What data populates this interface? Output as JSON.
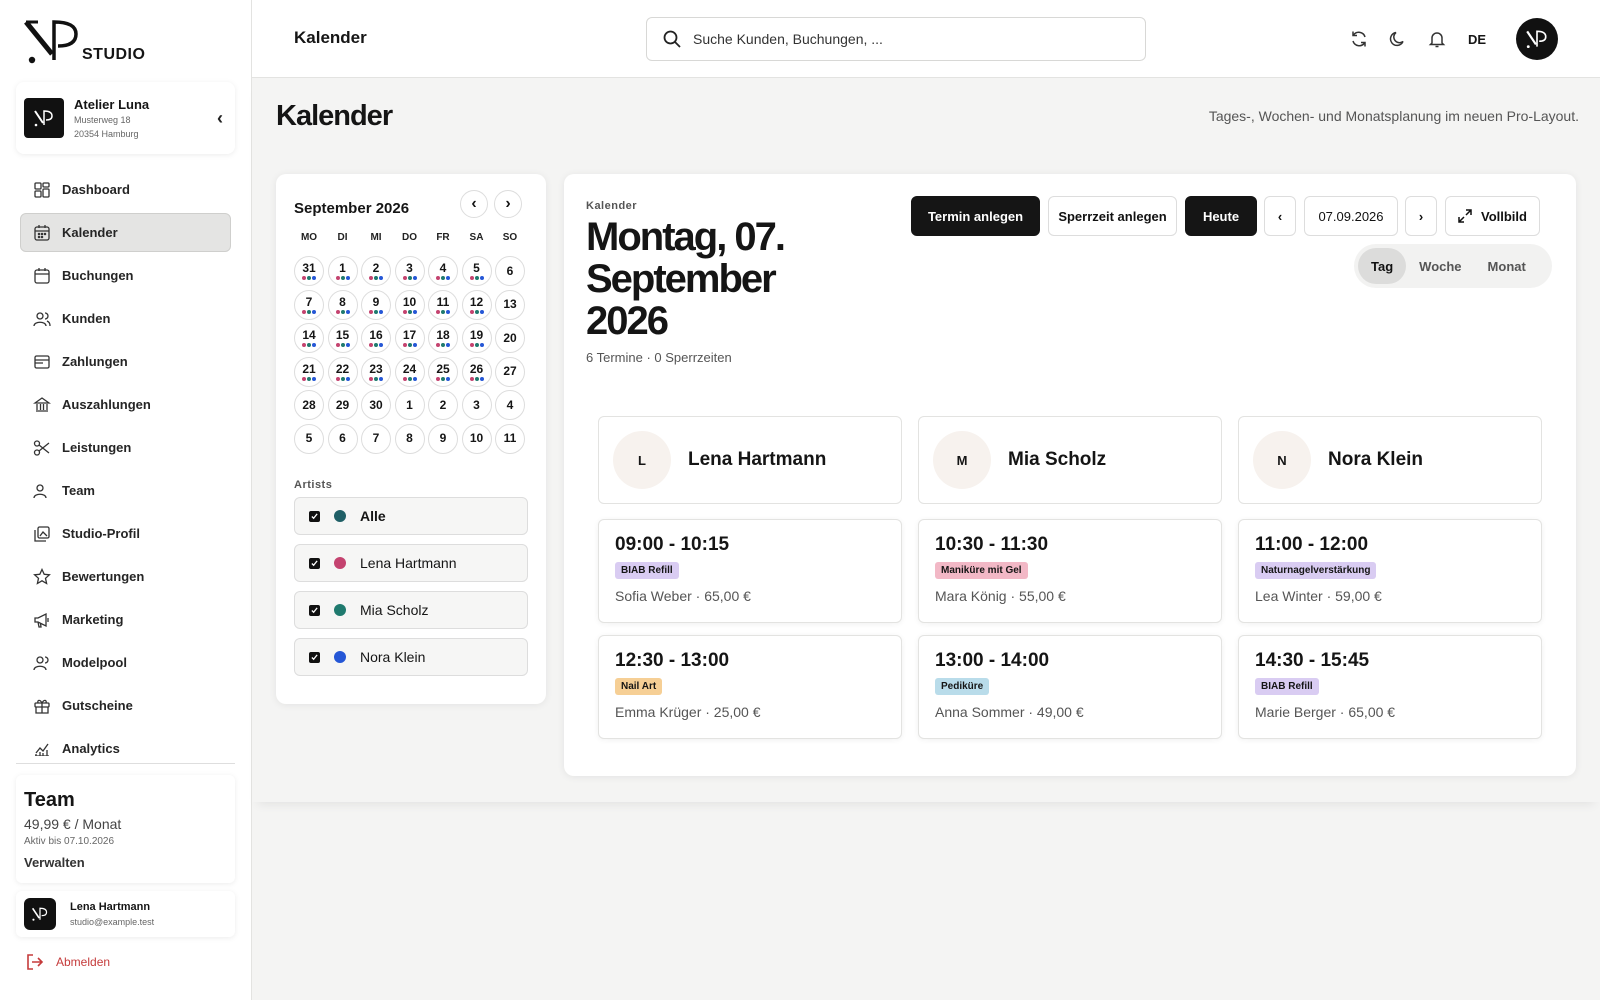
{
  "brand": {
    "word": "STUDIO"
  },
  "studio": {
    "name": "Atelier Luna",
    "street": "Musterweg 18",
    "city": "20354 Hamburg"
  },
  "nav": {
    "items": [
      {
        "label": "Dashboard",
        "icon": "dashboard-icon"
      },
      {
        "label": "Kalender",
        "icon": "calendar-icon",
        "active": true
      },
      {
        "label": "Buchungen",
        "icon": "bookings-icon"
      },
      {
        "label": "Kunden",
        "icon": "customers-icon"
      },
      {
        "label": "Zahlungen",
        "icon": "payments-icon"
      },
      {
        "label": "Auszahlungen",
        "icon": "bank-icon"
      },
      {
        "label": "Leistungen",
        "icon": "scissors-icon"
      },
      {
        "label": "Team",
        "icon": "team-icon"
      },
      {
        "label": "Studio-Profil",
        "icon": "profile-icon"
      },
      {
        "label": "Bewertungen",
        "icon": "star-icon"
      },
      {
        "label": "Marketing",
        "icon": "megaphone-icon"
      },
      {
        "label": "Modelpool",
        "icon": "modelpool-icon"
      },
      {
        "label": "Gutscheine",
        "icon": "gift-icon"
      },
      {
        "label": "Analytics",
        "icon": "chart-icon"
      }
    ]
  },
  "plan": {
    "name": "Team",
    "price": "49,99 € / Monat",
    "until": "Aktiv bis 07.10.2026",
    "manage": "Verwalten"
  },
  "user": {
    "name": "Lena Hartmann",
    "email": "studio@example.test"
  },
  "logout": "Abmelden",
  "topbar": {
    "title": "Kalender",
    "search_placeholder": "Suche Kunden, Buchungen, ...",
    "lang": "DE"
  },
  "page": {
    "title": "Kalender",
    "subtitle": "Tages-, Wochen- und Monatsplanung im neuen Pro-Layout."
  },
  "mini": {
    "month": "September 2026",
    "weekdays": [
      "MO",
      "DI",
      "MI",
      "DO",
      "FR",
      "SA",
      "SO"
    ],
    "weeks": [
      [
        "31",
        "1",
        "2",
        "3",
        "4",
        "5",
        "6"
      ],
      [
        "7",
        "8",
        "9",
        "10",
        "11",
        "12",
        "13"
      ],
      [
        "14",
        "15",
        "16",
        "17",
        "18",
        "19",
        "20"
      ],
      [
        "21",
        "22",
        "23",
        "24",
        "25",
        "26",
        "27"
      ],
      [
        "28",
        "29",
        "30",
        "1",
        "2",
        "3",
        "4"
      ],
      [
        "5",
        "6",
        "7",
        "8",
        "9",
        "10",
        "11"
      ]
    ],
    "busy_rows": 4,
    "busy_cols": 6,
    "dot_colors": [
      "#c4436f",
      "#1f7a6e",
      "#2557d6"
    ]
  },
  "artists": {
    "label": "Artists",
    "items": [
      {
        "name": "Alle",
        "color": "#1f5f66",
        "bold": true
      },
      {
        "name": "Lena Hartmann",
        "color": "#c4436f"
      },
      {
        "name": "Mia Scholz",
        "color": "#1f7a6e"
      },
      {
        "name": "Nora Klein",
        "color": "#2557d6"
      }
    ]
  },
  "main": {
    "kicker": "Kalender",
    "date": "Montag, 07. September 2026",
    "count": "6 Termine · 0 Sperrzeiten",
    "new_appointment": "Termin anlegen",
    "block_time": "Sperrzeit anlegen",
    "today": "Heute",
    "prev": "‹",
    "next": "›",
    "current_date": "07.09.2026",
    "fullscreen": "Vollbild",
    "views": [
      "Tag",
      "Woche",
      "Monat"
    ],
    "active_view": "Tag"
  },
  "columns": [
    {
      "initial": "L",
      "name": "Lena Hartmann",
      "appointments": [
        {
          "time": "09:00 - 10:15",
          "service": "BIAB Refill",
          "tag_color": "#d9ccf2",
          "info": "Sofia Weber · 65,00 €"
        },
        {
          "time": "12:30 - 13:00",
          "service": "Nail Art",
          "tag_color": "#f6cf95",
          "info": "Emma Krüger · 25,00 €"
        }
      ]
    },
    {
      "initial": "M",
      "name": "Mia Scholz",
      "appointments": [
        {
          "time": "10:30 - 11:30",
          "service": "Maniküre mit Gel",
          "tag_color": "#f2b8c6",
          "info": "Mara König · 55,00 €"
        },
        {
          "time": "13:00 - 14:00",
          "service": "Pediküre",
          "tag_color": "#b9dcea",
          "info": "Anna Sommer · 49,00 €"
        }
      ]
    },
    {
      "initial": "N",
      "name": "Nora Klein",
      "appointments": [
        {
          "time": "11:00 - 12:00",
          "service": "Naturnagelverstärkung",
          "tag_color": "#d9ccf2",
          "info": "Lea Winter · 59,00 €"
        },
        {
          "time": "14:30 - 15:45",
          "service": "BIAB Refill",
          "tag_color": "#d9ccf2",
          "info": "Marie Berger · 65,00 €"
        }
      ]
    }
  ]
}
